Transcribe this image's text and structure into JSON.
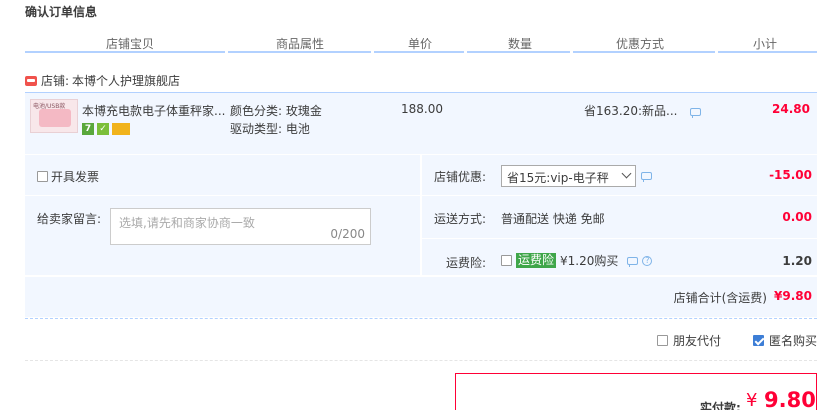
{
  "page": {
    "title": "确认订单信息"
  },
  "columns": [
    "店铺宝贝",
    "商品属性",
    "单价",
    "数量",
    "优惠方式",
    "小计"
  ],
  "shop": {
    "label": "店铺:",
    "name": "本博个人护理旗舰店"
  },
  "item": {
    "thumb_caption": "电池/USB款",
    "name": "本博充电款电子体重秤家...",
    "attr_color": "颜色分类: 玫瑰金",
    "attr_drive": "驱动类型: 电池",
    "price": "188.00",
    "discount": "省163.20:新品...",
    "subtotal": "24.80",
    "badge_7": "7"
  },
  "invoice": {
    "label": "开具发票"
  },
  "message": {
    "label": "给卖家留言:",
    "placeholder": "选填,请先和商家协商一致",
    "count": "0/200"
  },
  "coupon": {
    "label": "店铺优惠:",
    "selected": "省15元:vip-电子秤",
    "amount": "-15.00"
  },
  "shipping": {
    "label": "运送方式:",
    "value": "普通配送 快递 免邮",
    "amount": "0.00"
  },
  "insurance": {
    "label": "运费险:",
    "tag": "运费险",
    "value": "¥1.20购买",
    "amount": "1.20",
    "help": "?"
  },
  "shop_total": {
    "label": "店铺合计(含运费)",
    "value": "¥9.80"
  },
  "options": {
    "friend_pay": "朋友代付",
    "anonymous": "匿名购买"
  },
  "payment": {
    "label": "实付款:",
    "currency": "¥",
    "value": "9.80"
  },
  "colors": {
    "accent": "#ff0036",
    "panel": "#f2f7ff",
    "line": "#b2d1ff",
    "insurance": "#3fa64a"
  }
}
